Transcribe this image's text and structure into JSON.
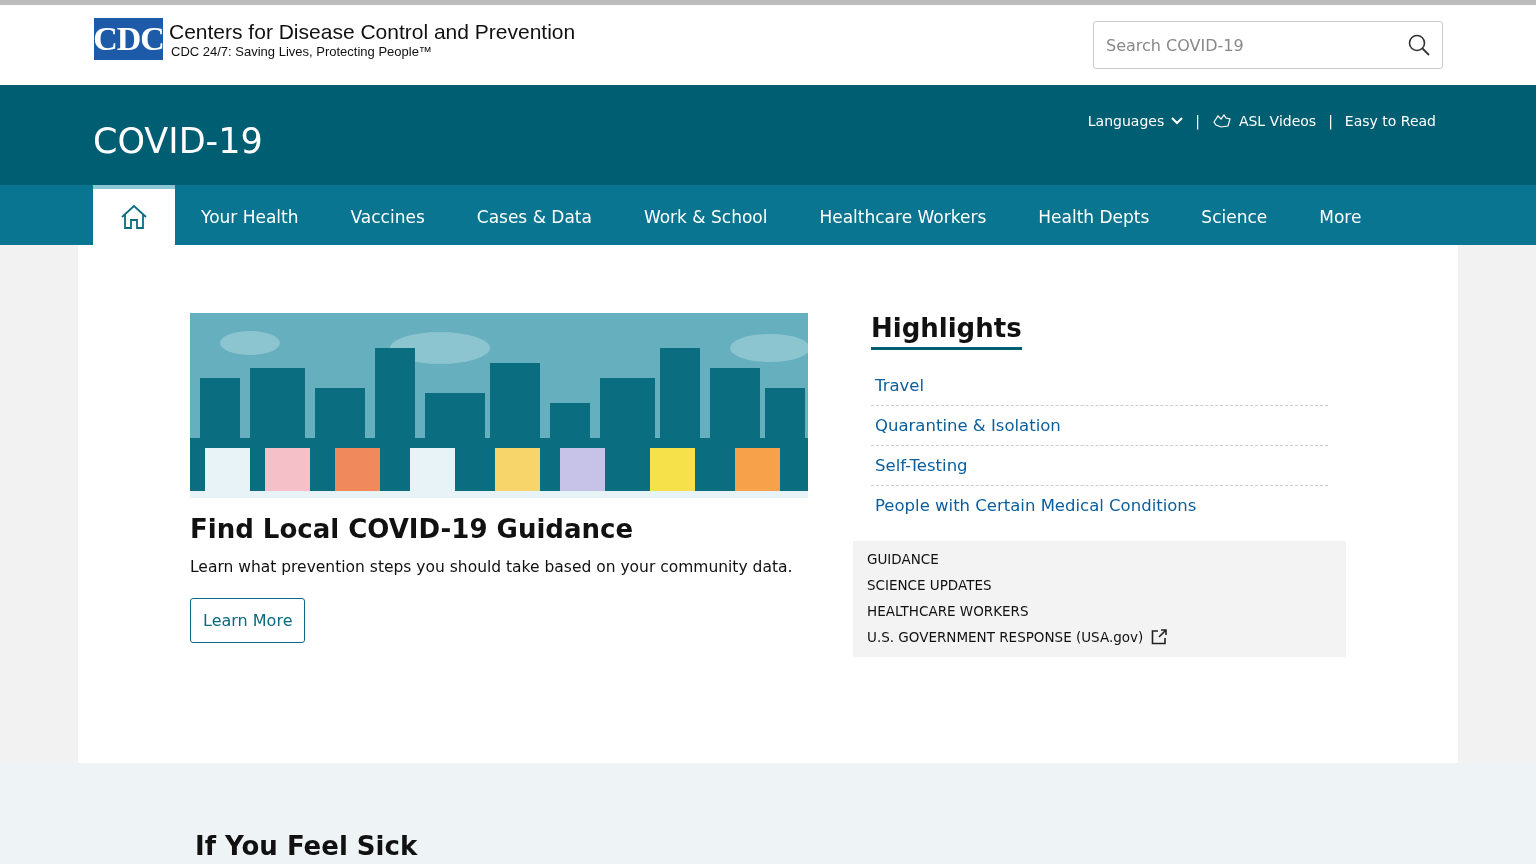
{
  "header": {
    "logo_mark": "CDC",
    "org_name": "Centers for Disease Control and Prevention",
    "tagline": "CDC 24/7: Saving Lives, Protecting People™",
    "search": {
      "placeholder": "Search COVID-19"
    }
  },
  "banner": {
    "title": "COVID-19",
    "separator": "|",
    "links": [
      {
        "kind": "dropdown",
        "label": "Languages"
      },
      {
        "kind": "asl",
        "label": "ASL Videos"
      },
      {
        "kind": "plain",
        "label": "Easy to Read"
      }
    ]
  },
  "nav": [
    {
      "kind": "home",
      "selected": true
    },
    {
      "kind": "text",
      "label": "Your Health",
      "selected": false
    },
    {
      "kind": "text",
      "label": "Vaccines",
      "selected": false
    },
    {
      "kind": "text",
      "label": "Cases & Data",
      "selected": false
    },
    {
      "kind": "text",
      "label": "Work & School",
      "selected": false
    },
    {
      "kind": "text",
      "label": "Healthcare Workers",
      "selected": false
    },
    {
      "kind": "text",
      "label": "Health Depts",
      "selected": false
    },
    {
      "kind": "text",
      "label": "Science",
      "selected": false
    },
    {
      "kind": "text",
      "label": "More",
      "selected": false
    }
  ],
  "feature": {
    "title": "Find Local COVID-19 Guidance",
    "text": "Learn what prevention steps you should take based on your community data.",
    "button": "Learn More"
  },
  "highlights": {
    "title": "Highlights",
    "links": [
      "Travel",
      "Quarantine & Isolation",
      "Self-Testing",
      "People with Certain Medical Conditions"
    ],
    "categories": [
      {
        "label": "GUIDANCE",
        "external": false
      },
      {
        "label": "SCIENCE UPDATES",
        "external": false
      },
      {
        "label": "HEALTHCARE WORKERS",
        "external": false
      },
      {
        "label": "U.S. GOVERNMENT RESPONSE (USA.gov)",
        "external": true
      }
    ]
  },
  "next_section": {
    "title": "If You Feel Sick"
  }
}
